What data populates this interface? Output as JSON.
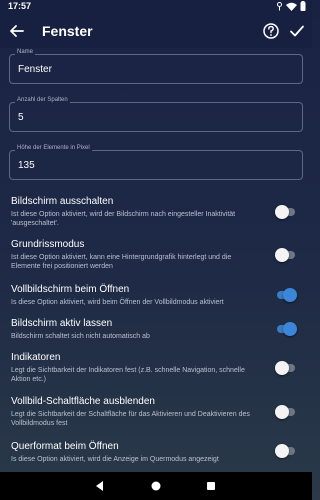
{
  "status": {
    "time": "17:57"
  },
  "appbar": {
    "title": "Fenster"
  },
  "fields": [
    {
      "label": "Name",
      "value": "Fenster"
    },
    {
      "label": "Anzahl der Spalten",
      "value": "5"
    },
    {
      "label": "Höhe der Elemente in Pixel",
      "value": "135"
    }
  ],
  "options": [
    {
      "title": "Bildschirm ausschalten",
      "desc": "Ist diese Option aktiviert, wird der Bildschirm nach eingesteller Inaktivität 'ausgeschaltet'.",
      "enabled": false
    },
    {
      "title": "Grundrissmodus",
      "desc": "Ist diese Option aktiviert, kann eine Hintergrundgrafik hinterlegt und die Elemente frei positioniert werden",
      "enabled": false
    },
    {
      "title": "Vollbildschirm beim Öffnen",
      "desc": "Is diese Option aktiviert, wird beim Öffnen der Vollbildmodus aktiviert",
      "enabled": true
    },
    {
      "title": "Bildschirm aktiv lassen",
      "desc": "Bildschirm schaltet sich nicht automatisch ab",
      "enabled": true
    },
    {
      "title": "Indikatoren",
      "desc": "Legt die Sichtbarkeit der Indikatoren fest (z.B. schnelle Navigation, schnelle Aktion etc.)",
      "enabled": false
    },
    {
      "title": "Vollbild-Schaltfläche ausblenden",
      "desc": "Legt die Sichtbarkeit der Schaltfläche für das Aktivieren und Deaktivieren des Vollbildmodus fest",
      "enabled": false
    },
    {
      "title": "Querformat beim Öffnen",
      "desc": "Is diese Option aktiviert, wird die Anzeige im Quermodus angezeigt",
      "enabled": false
    }
  ],
  "icons": {
    "back": "arrow-back-icon",
    "help": "help-circle-icon",
    "confirm": "check-icon",
    "nav_back": "nav-back-icon",
    "nav_home": "nav-home-icon",
    "nav_recents": "nav-recents-icon"
  },
  "colors": {
    "toggle_on": "#3b86d8",
    "toggle_off": "#f4f4f4",
    "background": "#1a2244"
  }
}
